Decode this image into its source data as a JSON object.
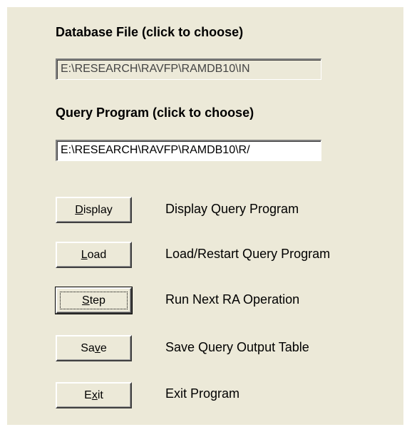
{
  "database_file": {
    "label": "Database File (click to choose)",
    "value": "E:\\RESEARCH\\RAVFP\\RAMDB10\\IN"
  },
  "query_program": {
    "label": "Query Program (click to choose)",
    "value": "E:\\RESEARCH\\RAVFP\\RAMDB10\\R/"
  },
  "actions": [
    {
      "pre": "",
      "key": "D",
      "post": "isplay",
      "description": "Display Query Program"
    },
    {
      "pre": "",
      "key": "L",
      "post": "oad",
      "description": "Load/Restart Query Program"
    },
    {
      "pre": "",
      "key": "S",
      "post": "tep",
      "description": "Run Next RA Operation"
    },
    {
      "pre": "Sa",
      "key": "v",
      "post": "e",
      "description": "Save Query Output Table"
    },
    {
      "pre": "E",
      "key": "x",
      "post": "it",
      "description": "Exit Program"
    }
  ],
  "colors": {
    "panel_background": "#ece9d8",
    "page_background": "#ffffff",
    "text": "#000000"
  }
}
